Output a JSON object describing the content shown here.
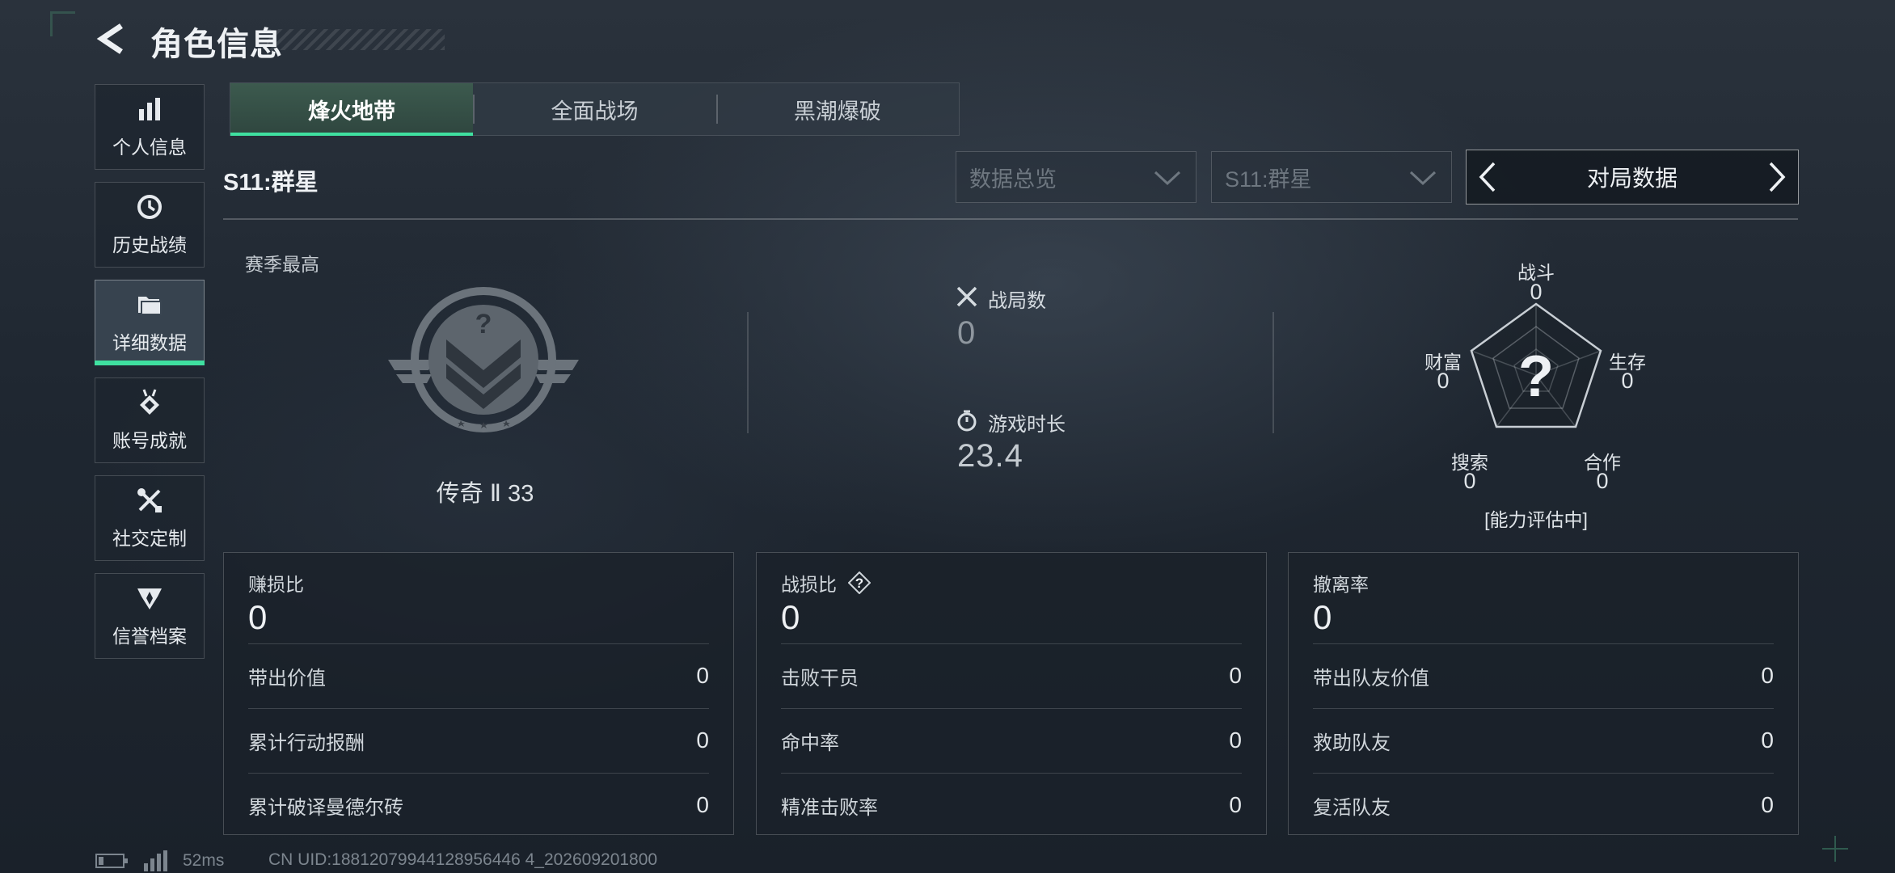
{
  "header": {
    "title": "角色信息"
  },
  "sidebar": {
    "items": [
      {
        "label": "个人信息",
        "icon": "bar-chart-icon",
        "active": false
      },
      {
        "label": "历史战绩",
        "icon": "history-clock-icon",
        "active": false
      },
      {
        "label": "详细数据",
        "icon": "folder-icon",
        "active": true
      },
      {
        "label": "账号成就",
        "icon": "medal-icon",
        "active": false
      },
      {
        "label": "社交定制",
        "icon": "tools-icon",
        "active": false
      },
      {
        "label": "信誉档案",
        "icon": "shield-wing-icon",
        "active": false
      }
    ]
  },
  "tabs": [
    {
      "label": "烽火地带",
      "active": true
    },
    {
      "label": "全面战场",
      "active": false
    },
    {
      "label": "黑潮爆破",
      "active": false
    }
  ],
  "season": {
    "name": "S11:群星"
  },
  "filters": {
    "overview_label": "数据总览",
    "season_label": "S11:群星",
    "mode_label": "对局数据"
  },
  "season_best": {
    "label": "赛季最高",
    "rank": "传奇 Ⅱ 33"
  },
  "stats": {
    "matches_label": "战局数",
    "matches_value": "0",
    "playtime_label": "游戏时长",
    "playtime_value": "23.4"
  },
  "radar": {
    "axes": [
      {
        "label": "战斗",
        "value": "0"
      },
      {
        "label": "生存",
        "value": "0"
      },
      {
        "label": "合作",
        "value": "0"
      },
      {
        "label": "搜索",
        "value": "0"
      },
      {
        "label": "财富",
        "value": "0"
      }
    ],
    "center_symbol": "?",
    "status": "[能力评估中]"
  },
  "cards": [
    {
      "title": "赚损比",
      "value": "0",
      "has_help": false,
      "rows": [
        {
          "label": "带出价值",
          "value": "0"
        },
        {
          "label": "累计行动报酬",
          "value": "0"
        },
        {
          "label": "累计破译曼德尔砖",
          "value": "0"
        }
      ]
    },
    {
      "title": "战损比",
      "value": "0",
      "has_help": true,
      "rows": [
        {
          "label": "击败干员",
          "value": "0"
        },
        {
          "label": "命中率",
          "value": "0"
        },
        {
          "label": "精准击败率",
          "value": "0"
        }
      ]
    },
    {
      "title": "撤离率",
      "value": "0",
      "has_help": false,
      "rows": [
        {
          "label": "带出队友价值",
          "value": "0"
        },
        {
          "label": "救助队友",
          "value": "0"
        },
        {
          "label": "复活队友",
          "value": "0"
        }
      ]
    }
  ],
  "footer": {
    "ping": "52ms",
    "uid": "CN UID:18812079944128956446 4_202609201800"
  },
  "colors": {
    "accent": "#3fe0a0",
    "background": "#1f2731"
  }
}
